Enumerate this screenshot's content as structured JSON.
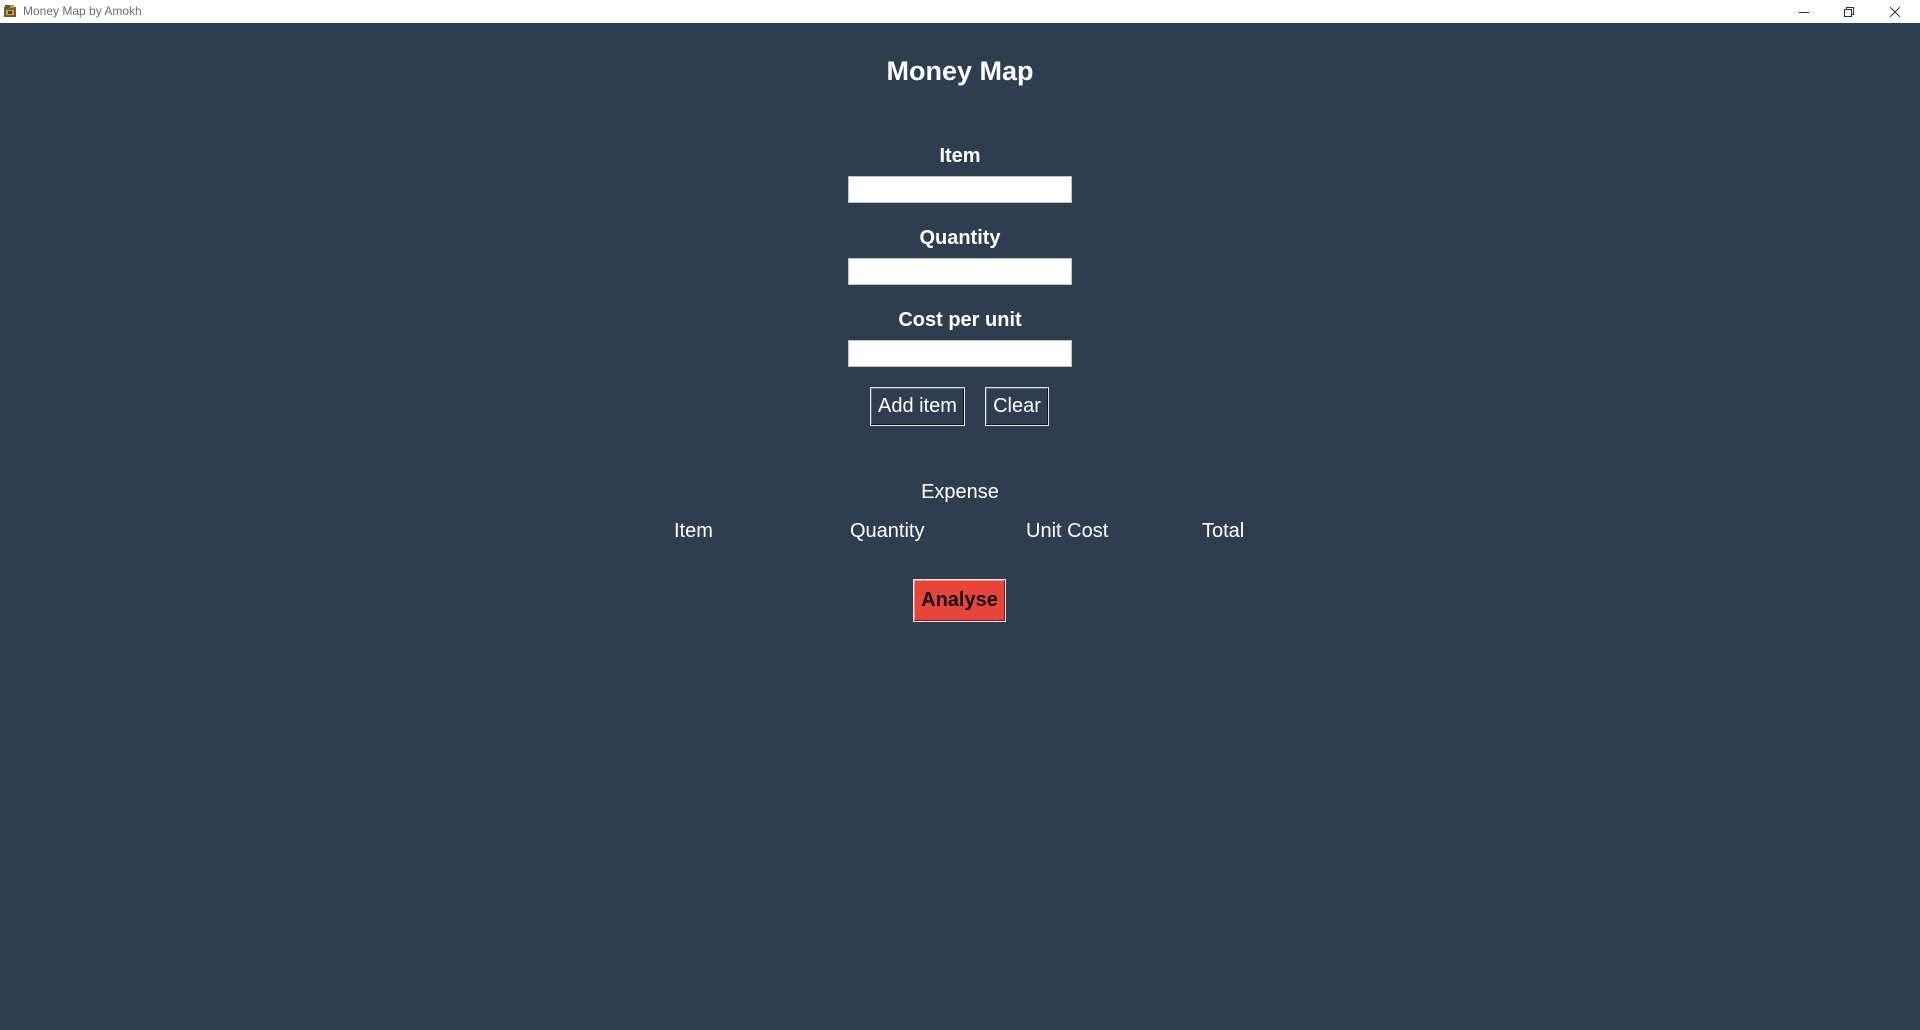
{
  "window": {
    "title": "Money Map by Amokh",
    "app_icon": "money-map-app-icon",
    "controls": {
      "minimize_icon": "minimize-icon",
      "maximize_icon": "restore-icon",
      "close_icon": "close-icon"
    }
  },
  "form": {
    "heading": "Money Map",
    "item_label": "Item",
    "item_value": "",
    "quantity_label": "Quantity",
    "quantity_value": "",
    "cost_label": "Cost per unit",
    "cost_value": "",
    "add_button": "Add item",
    "clear_button": "Clear"
  },
  "expense": {
    "title": "Expense",
    "columns": [
      "Item",
      "Quantity",
      "Unit Cost",
      "Total"
    ],
    "rows": []
  },
  "actions": {
    "analyse_button": "Analyse"
  },
  "colors": {
    "background": "#2e3d50",
    "analyse_button": "#e7443a",
    "text": "#ffffff"
  }
}
